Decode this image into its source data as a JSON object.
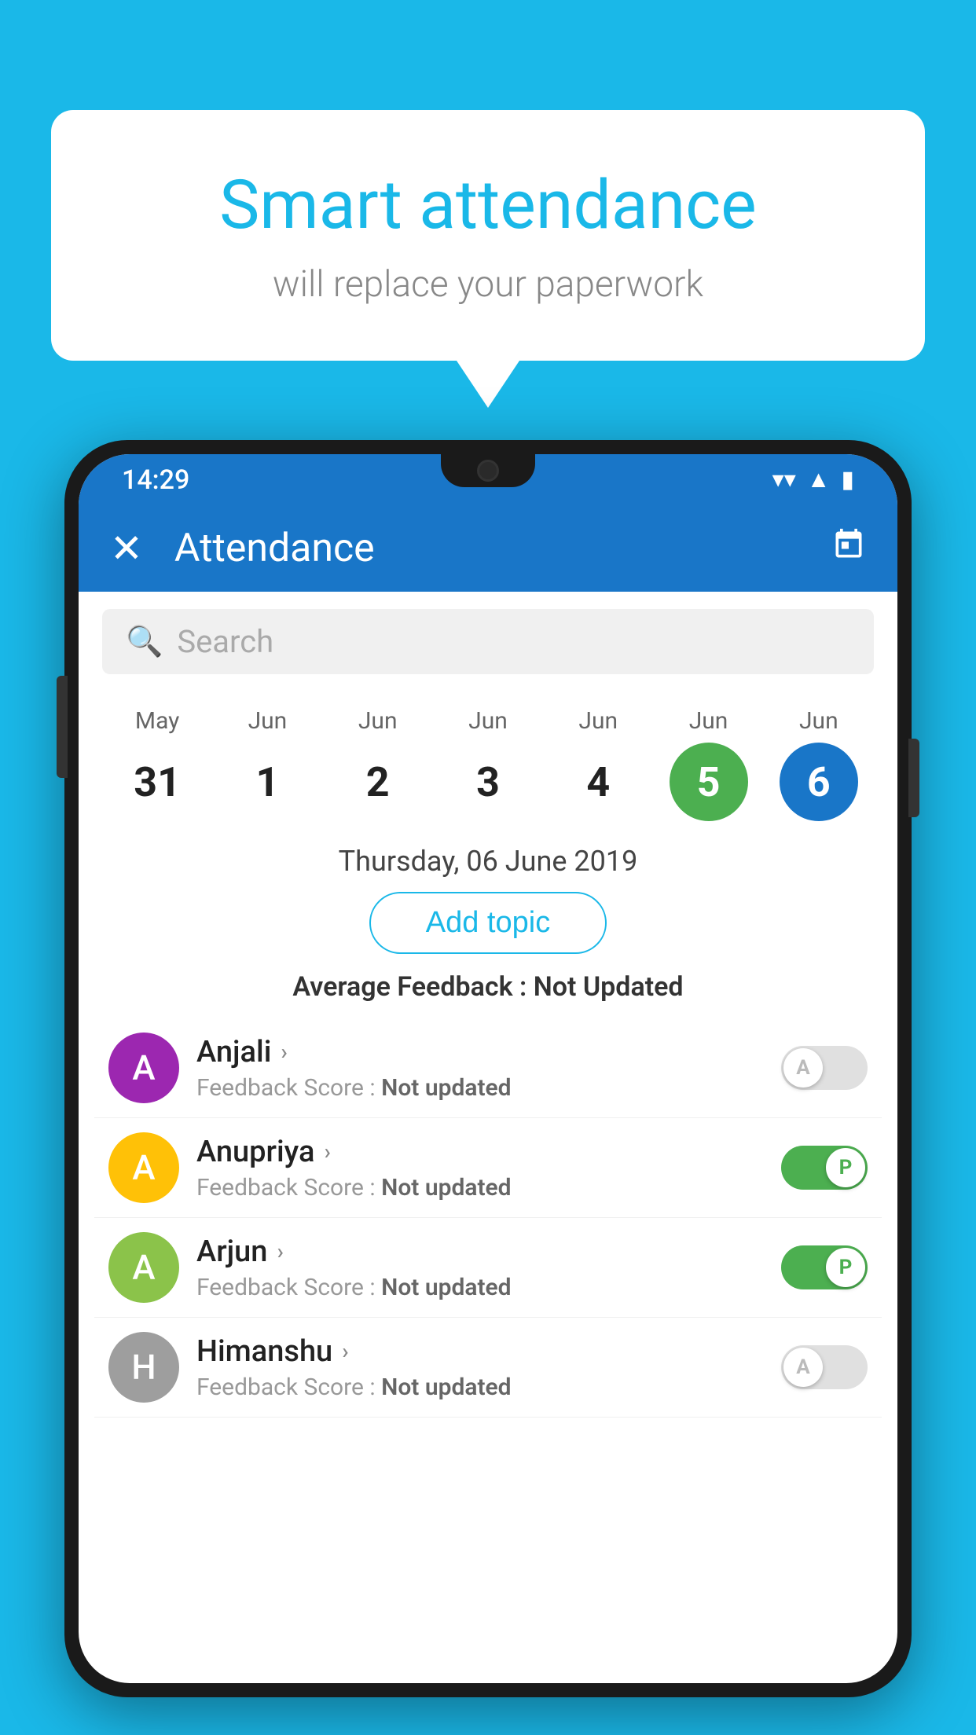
{
  "background_color": "#1ab8e8",
  "speech_bubble": {
    "title": "Smart attendance",
    "subtitle": "will replace your paperwork"
  },
  "status_bar": {
    "time": "14:29",
    "wifi_icon": "▾",
    "signal_icon": "▲",
    "battery_icon": "▮"
  },
  "app_bar": {
    "title": "Attendance",
    "close_icon": "✕",
    "calendar_icon": "📅"
  },
  "search": {
    "placeholder": "Search"
  },
  "calendar": {
    "days": [
      {
        "month": "May",
        "date": "31",
        "state": "normal"
      },
      {
        "month": "Jun",
        "date": "1",
        "state": "normal"
      },
      {
        "month": "Jun",
        "date": "2",
        "state": "normal"
      },
      {
        "month": "Jun",
        "date": "3",
        "state": "normal"
      },
      {
        "month": "Jun",
        "date": "4",
        "state": "normal"
      },
      {
        "month": "Jun",
        "date": "5",
        "state": "today"
      },
      {
        "month": "Jun",
        "date": "6",
        "state": "selected"
      }
    ]
  },
  "selected_date_label": "Thursday, 06 June 2019",
  "add_topic_button": "Add topic",
  "average_feedback_label": "Average Feedback :",
  "average_feedback_value": "Not Updated",
  "students": [
    {
      "name": "Anjali",
      "avatar_letter": "A",
      "avatar_color": "#9c27b0",
      "feedback_label": "Feedback Score :",
      "feedback_value": "Not updated",
      "toggle": "off",
      "toggle_letter": "A"
    },
    {
      "name": "Anupriya",
      "avatar_letter": "A",
      "avatar_color": "#ffc107",
      "feedback_label": "Feedback Score :",
      "feedback_value": "Not updated",
      "toggle": "on",
      "toggle_letter": "P"
    },
    {
      "name": "Arjun",
      "avatar_letter": "A",
      "avatar_color": "#8bc34a",
      "feedback_label": "Feedback Score :",
      "feedback_value": "Not updated",
      "toggle": "on",
      "toggle_letter": "P"
    },
    {
      "name": "Himanshu",
      "avatar_letter": "H",
      "avatar_color": "#9e9e9e",
      "feedback_label": "Feedback Score :",
      "feedback_value": "Not updated",
      "toggle": "off",
      "toggle_letter": "A"
    }
  ]
}
